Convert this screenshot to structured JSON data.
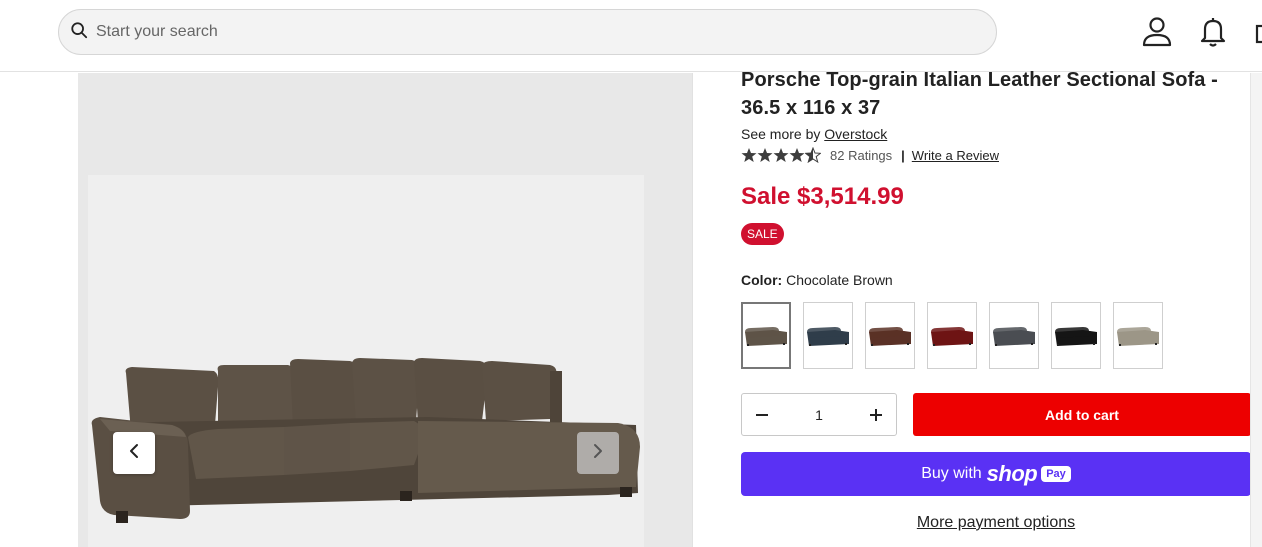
{
  "header": {
    "search_placeholder": "Start your search"
  },
  "product": {
    "title": "Porsche Top-grain Italian Leather Sectional Sofa - 36.5 x 116 x 37",
    "see_more_prefix": "See more by ",
    "brand": "Overstock",
    "rating": 4.5,
    "ratings_count": "82 Ratings",
    "separator": "|",
    "write_review": "Write a Review",
    "price": "Sale $3,514.99",
    "sale_badge": "SALE",
    "color_label": "Color:",
    "color_value": "Chocolate Brown",
    "swatch_colors": [
      "#5e5448",
      "#2f3d4a",
      "#5a3126",
      "#6e1414",
      "#4a4d52",
      "#151515",
      "#9c9687"
    ],
    "quantity": "1",
    "add_to_cart": "Add to cart",
    "buy_with": "Buy with",
    "shop_word": "shop",
    "pay_word": "Pay",
    "more_payment": "More payment options"
  },
  "colors": {
    "price_red": "#d0102f",
    "cart_red": "#ed0000",
    "shop_purple": "#5a31f4",
    "sofa_brown": "#5b5044"
  }
}
